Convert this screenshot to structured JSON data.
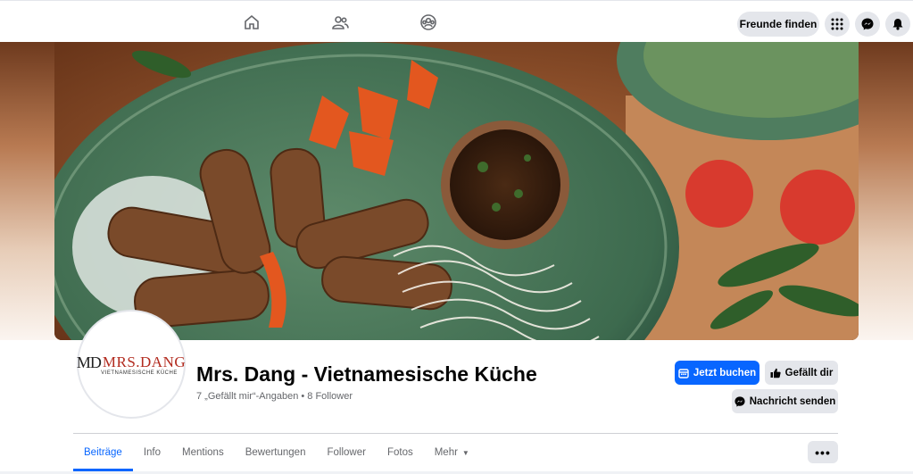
{
  "nav": {
    "find_friends": "Freunde finden"
  },
  "page": {
    "logo_mark": "MD",
    "logo_name": "MRS.DANG",
    "logo_sub": "VIETNAMESISCHE KÜCHE",
    "title": "Mrs. Dang - Vietnamesische Küche",
    "meta": "7 „Gefällt mir“-Angaben • 8 Follower"
  },
  "actions": {
    "book": "Jetzt buchen",
    "like": "Gefällt dir",
    "message": "Nachricht senden"
  },
  "tabs": [
    {
      "label": "Beiträge"
    },
    {
      "label": "Info"
    },
    {
      "label": "Mentions"
    },
    {
      "label": "Bewertungen"
    },
    {
      "label": "Follower"
    },
    {
      "label": "Fotos"
    },
    {
      "label": "Mehr"
    }
  ],
  "more_button": "•••",
  "colors": {
    "accent": "#0866ff",
    "logo_red": "#b22b1f",
    "grey_button": "#e4e6eb"
  },
  "icons": [
    "home-icon",
    "friends-icon",
    "groups-icon",
    "apps-grid-icon",
    "messenger-icon",
    "bell-icon",
    "calendar-icon",
    "thumbs-up-icon",
    "chevron-down-icon"
  ]
}
